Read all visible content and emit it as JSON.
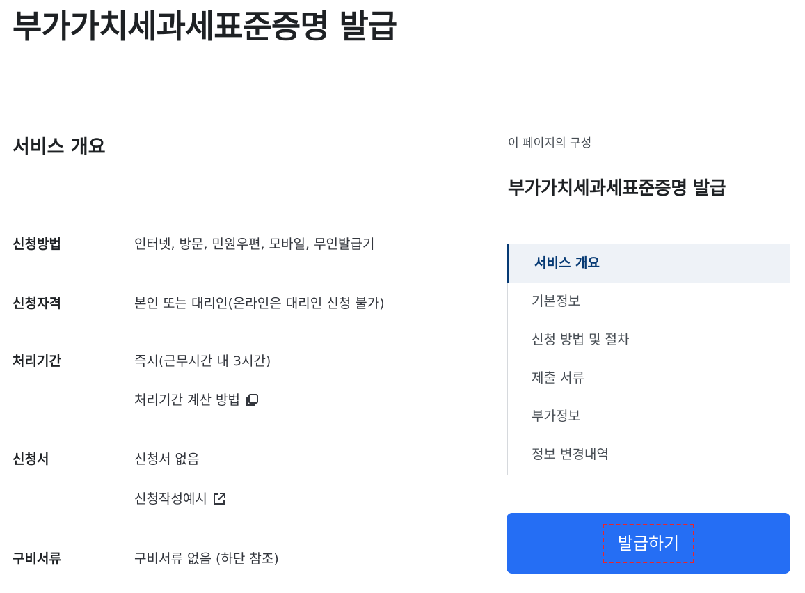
{
  "page": {
    "title": "부가가치세과세표준증명 발급"
  },
  "overview": {
    "title": "서비스 개요",
    "rows": [
      {
        "label": "신청방법",
        "value": "인터넷, 방문, 민원우편, 모바일, 무인발급기"
      },
      {
        "label": "신청자격",
        "value": "본인 또는 대리인(온라인은 대리인 신청 불가)"
      },
      {
        "label": "처리기간",
        "value": "즉시(근무시간 내 3시간)",
        "link": "처리기간 계산 방법",
        "link_icon": "copy-icon"
      },
      {
        "label": "신청서",
        "value": "신청서 없음",
        "link": "신청작성예시",
        "link_icon": "external-link-icon"
      },
      {
        "label": "구비서류",
        "value": "구비서류 없음 (하단 참조)"
      }
    ]
  },
  "toc": {
    "caption": "이 페이지의 구성",
    "title": "부가가치세과세표준증명 발급",
    "items": [
      {
        "label": "서비스 개요",
        "active": true
      },
      {
        "label": "기본정보"
      },
      {
        "label": "신청 방법 및 절차"
      },
      {
        "label": "제출 서류"
      },
      {
        "label": "부가정보"
      },
      {
        "label": "정보 변경내역"
      }
    ]
  },
  "actions": {
    "apply_label": "발급하기"
  },
  "colors": {
    "primary": "#256ef4",
    "toc_active_bar": "#063a74",
    "focus_outline": "#e8262b"
  }
}
